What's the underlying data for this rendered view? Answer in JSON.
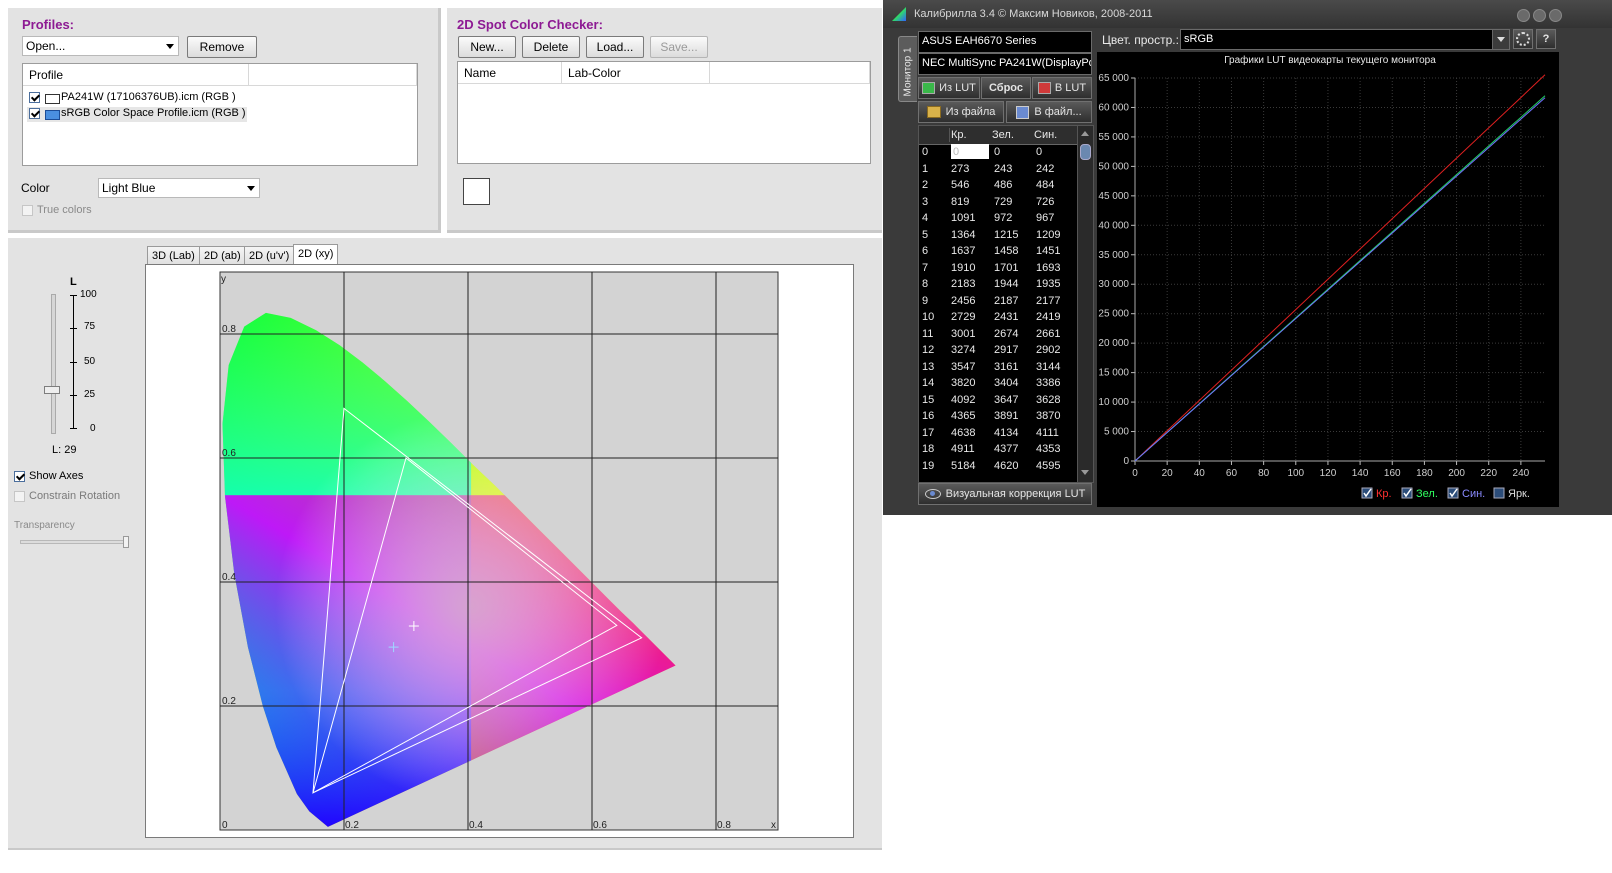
{
  "left": {
    "profiles": {
      "title": "Profiles:",
      "open_label": "Open...",
      "remove_label": "Remove",
      "column_header": "Profile",
      "items": [
        {
          "label": "PA241W (17106376UB).icm (RGB )",
          "checked": true,
          "swatch": "#ffffff"
        },
        {
          "label": "sRGB Color Space Profile.icm (RGB )",
          "checked": true,
          "swatch": "#4a8fe0"
        }
      ],
      "color_label": "Color",
      "color_value": "Light Blue",
      "true_colors_label": "True colors"
    },
    "spot": {
      "title": "2D Spot Color Checker:",
      "buttons": [
        "New...",
        "Delete",
        "Load...",
        "Save..."
      ],
      "columns": [
        "Name",
        "Lab-Color"
      ]
    },
    "controls": {
      "l_label": "L",
      "l_ticks": [
        "100",
        "75",
        "50",
        "25",
        "0"
      ],
      "l_value_text": "L: 29",
      "l_value": 29,
      "show_axes_label": "Show Axes",
      "constrain_label": "Constrain Rotation",
      "transparency_label": "Transparency"
    },
    "tabs": [
      "3D (Lab)",
      "2D (ab)",
      "2D (u'v')",
      "2D (xy)"
    ],
    "active_tab": "2D (xy)",
    "plot": {
      "y_axis_letter": "y",
      "x_axis_letter": "x",
      "y_labels": [
        "0.8",
        "0.6",
        "0.4",
        "0.2",
        "0"
      ],
      "x_labels": [
        "0.2",
        "0.4",
        "0.6",
        "0.8"
      ],
      "gamut_pa241w": [
        [
          0.68,
          0.31
        ],
        [
          0.2,
          0.68
        ],
        [
          0.15,
          0.06
        ]
      ],
      "gamut_srgb": [
        [
          0.64,
          0.33
        ],
        [
          0.3,
          0.6
        ],
        [
          0.15,
          0.06
        ]
      ]
    }
  },
  "right": {
    "title": "Калибрилла 3.4 © Максим Новиков,  2008-2011",
    "vertical_tab": "Монитор 1",
    "gpu": "ASUS EAH6670 Series",
    "monitor": "NEC MultiSync PA241W(DisplayPort)",
    "colorspace_label": "Цвет. простр.:",
    "colorspace_value": "sRGB",
    "btn_from_lut": "Из LUT",
    "btn_reset": "Сброс",
    "btn_to_lut": "В LUT",
    "btn_from_file": "Из файла",
    "btn_to_file": "В файл...",
    "table_headers": [
      "Кр.",
      "Зел.",
      "Син."
    ],
    "table_rows": [
      [
        "0",
        "0",
        "0",
        "0"
      ],
      [
        "1",
        "273",
        "243",
        "242"
      ],
      [
        "2",
        "546",
        "486",
        "484"
      ],
      [
        "3",
        "819",
        "729",
        "726"
      ],
      [
        "4",
        "1091",
        "972",
        "967"
      ],
      [
        "5",
        "1364",
        "1215",
        "1209"
      ],
      [
        "6",
        "1637",
        "1458",
        "1451"
      ],
      [
        "7",
        "1910",
        "1701",
        "1693"
      ],
      [
        "8",
        "2183",
        "1944",
        "1935"
      ],
      [
        "9",
        "2456",
        "2187",
        "2177"
      ],
      [
        "10",
        "2729",
        "2431",
        "2419"
      ],
      [
        "11",
        "3001",
        "2674",
        "2661"
      ],
      [
        "12",
        "3274",
        "2917",
        "2902"
      ],
      [
        "13",
        "3547",
        "3161",
        "3144"
      ],
      [
        "14",
        "3820",
        "3404",
        "3386"
      ],
      [
        "15",
        "4092",
        "3647",
        "3628"
      ],
      [
        "16",
        "4365",
        "3891",
        "3870"
      ],
      [
        "17",
        "4638",
        "4134",
        "4111"
      ],
      [
        "18",
        "4911",
        "4377",
        "4353"
      ],
      [
        "19",
        "5184",
        "4620",
        "4595"
      ]
    ],
    "visual_correction": "Визуальная коррекция LUT",
    "chart_data": {
      "type": "line",
      "title": "Графики LUT видеокарты текущего монитора",
      "x_ticks": [
        "0",
        "20",
        "40",
        "60",
        "80",
        "100",
        "120",
        "140",
        "160",
        "180",
        "200",
        "220",
        "240"
      ],
      "y_ticks": [
        "0",
        "5 000",
        "10 000",
        "15 000",
        "20 000",
        "25 000",
        "30 000",
        "35 000",
        "40 000",
        "45 000",
        "50 000",
        "55 000",
        "60 000",
        "65 000"
      ],
      "xlim": [
        0,
        255
      ],
      "ylim": [
        0,
        65000
      ],
      "series": [
        {
          "name": "Кр.",
          "color": "#e02020",
          "x": [
            0,
            255
          ],
          "y": [
            0,
            65535
          ]
        },
        {
          "name": "Зел.",
          "color": "#20d060",
          "x": [
            0,
            255
          ],
          "y": [
            0,
            61980
          ]
        },
        {
          "name": "Син.",
          "color": "#7070ff",
          "x": [
            0,
            255
          ],
          "y": [
            0,
            61650
          ]
        }
      ],
      "legend": [
        "Кр.",
        "Зел.",
        "Син.",
        "Ярк."
      ],
      "legend_colors": [
        "#ff3030",
        "#30ff60",
        "#8a8aff",
        "#dddddd"
      ]
    }
  }
}
